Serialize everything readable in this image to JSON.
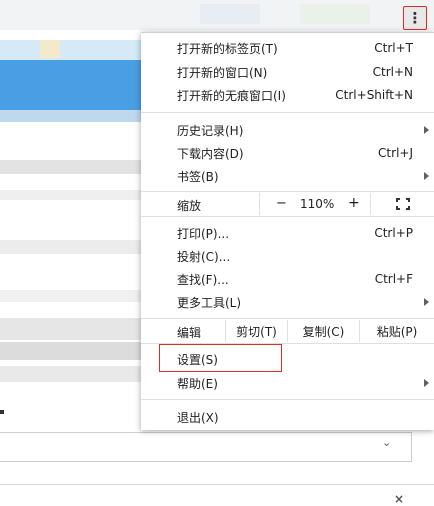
{
  "menu_button": {
    "icon": "more-vert-icon",
    "glyph": "⋮"
  },
  "menu": {
    "new_tab": {
      "label": "打开新的标签页(T)",
      "shortcut": "Ctrl+T"
    },
    "new_window": {
      "label": "打开新的窗口(N)",
      "shortcut": "Ctrl+N"
    },
    "new_incognito": {
      "label": "打开新的无痕窗口(I)",
      "shortcut": "Ctrl+Shift+N"
    },
    "history": {
      "label": "历史记录(H)"
    },
    "downloads": {
      "label": "下载内容(D)",
      "shortcut": "Ctrl+J"
    },
    "bookmarks": {
      "label": "书签(B)"
    },
    "zoom": {
      "label": "缩放",
      "minus": "−",
      "value": "110%",
      "plus": "+"
    },
    "print": {
      "label": "打印(P)...",
      "shortcut": "Ctrl+P"
    },
    "cast": {
      "label": "投射(C)..."
    },
    "find": {
      "label": "查找(F)...",
      "shortcut": "Ctrl+F"
    },
    "more_tools": {
      "label": "更多工具(L)"
    },
    "edit": {
      "label": "编辑",
      "cut": "剪切(T)",
      "copy": "复制(C)",
      "paste": "粘贴(P)"
    },
    "settings": {
      "label": "设置(S)"
    },
    "help": {
      "label": "帮助(E)"
    },
    "exit": {
      "label": "退出(X)"
    }
  },
  "background": {
    "input_chevron": "⌄",
    "close_glyph": "×"
  },
  "colors": {
    "highlight": "#d93025",
    "separator": "#e0e0e0",
    "menu_bg": "#ffffff"
  }
}
